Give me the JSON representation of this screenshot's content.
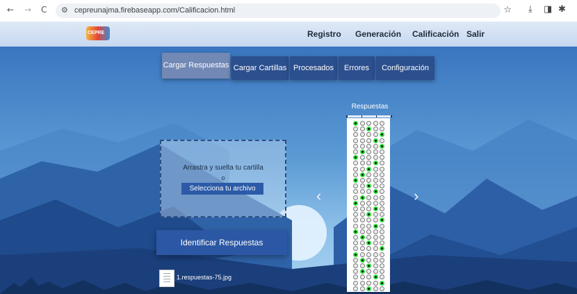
{
  "browser": {
    "url": "cepreunajma.firebaseapp.com/Calificacion.html",
    "back_icon": "←",
    "forward_icon": "→",
    "reload_icon": "C",
    "tune_icon": "⚙",
    "star_icon": "☆",
    "download_icon": "⤓",
    "sidepanel_icon": "◨",
    "extension_icon": "✱"
  },
  "navbar": {
    "logo_text": "CEPRE",
    "links": [
      "Registro",
      "Generación",
      "Calificación",
      "Salir"
    ]
  },
  "tabs": [
    {
      "label": "Cargar Respuestas",
      "active": true
    },
    {
      "label": "Cargar Cartillas",
      "active": false
    },
    {
      "label": "Procesados",
      "active": false
    },
    {
      "label": "Errores",
      "active": false
    },
    {
      "label": "Configuración",
      "active": false
    }
  ],
  "dropzone": {
    "prompt": "Arrastra y suelta tu cartilla",
    "or": "o",
    "select_label": "Selecciona tu archivo"
  },
  "identify_label": "Identificar Respuestas",
  "file": {
    "name": "1.respuestas-75.jpg"
  },
  "carousel": {
    "title": "Respuestas",
    "prev_icon": "‹",
    "next_icon": "›",
    "sheet_marks": [
      1,
      3,
      5,
      4,
      5,
      2,
      1,
      4,
      3,
      2,
      1,
      3,
      4,
      2,
      1,
      4,
      3,
      5,
      4,
      1,
      2,
      3,
      5,
      1,
      2,
      3,
      2,
      4,
      5,
      3
    ]
  }
}
